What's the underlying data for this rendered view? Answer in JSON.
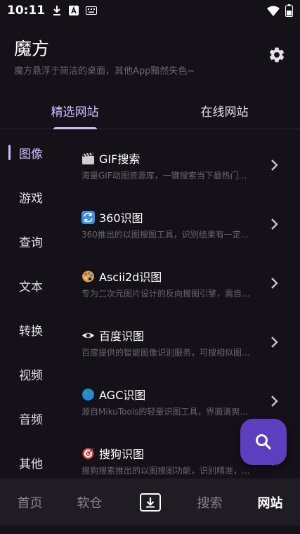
{
  "status_bar": {
    "time": "10:11",
    "icons": [
      "download-icon",
      "a-icon",
      "keyboard-icon",
      "wifi-icon",
      "battery-icon"
    ]
  },
  "header": {
    "title": "魔方",
    "subtitle": "魔方悬浮于简洁的桌面，其他App黯然失色~",
    "settings_icon": "gear-icon"
  },
  "tabs": [
    {
      "label": "精选网站",
      "active": true
    },
    {
      "label": "在线网站",
      "active": false
    }
  ],
  "categories": [
    {
      "label": "图像",
      "active": true
    },
    {
      "label": "游戏",
      "active": false
    },
    {
      "label": "查询",
      "active": false
    },
    {
      "label": "文本",
      "active": false
    },
    {
      "label": "转换",
      "active": false
    },
    {
      "label": "视频",
      "active": false
    },
    {
      "label": "音频",
      "active": false
    },
    {
      "label": "其他",
      "active": false
    }
  ],
  "sites": [
    {
      "icon": "clapper-board-icon",
      "name": "GIF搜索",
      "desc": "海量GIF动图资源库，一键搜索当下最热门..."
    },
    {
      "icon": "refresh-arrows-icon",
      "name": "360识图",
      "desc": "360推出的以图搜图工具，识别结果有一定..."
    },
    {
      "icon": "palette-icon",
      "name": "Ascii2d识图",
      "desc": "专为二次元图片设计的反向搜图引擎，需自..."
    },
    {
      "icon": "eye-icon",
      "name": "百度识图",
      "desc": "百度提供的智能图像识别服务，可搜相似图..."
    },
    {
      "icon": "globe-icon",
      "name": "AGC识图",
      "desc": "源自MikuTools的轻量识图工具，界面清爽..."
    },
    {
      "icon": "target-icon",
      "name": "搜狗识图",
      "desc": "搜狗搜索推出的以图搜图功能，识别精准，..."
    }
  ],
  "fab": {
    "icon": "search-icon"
  },
  "bottom_nav": [
    {
      "label": "首页",
      "active": false
    },
    {
      "label": "软仓",
      "active": false
    },
    {
      "label": "",
      "icon": "download-box-icon",
      "active": false
    },
    {
      "label": "搜索",
      "active": false
    },
    {
      "label": "网站",
      "active": true
    }
  ],
  "colors": {
    "background": "#141218",
    "accent": "#d0bcff",
    "fab": "#5b3fbf",
    "nav_bg": "#1f1c24"
  }
}
